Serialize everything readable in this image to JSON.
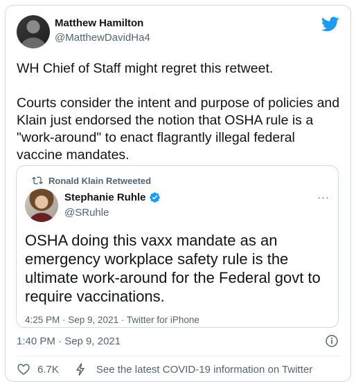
{
  "tweet": {
    "author_name": "Matthew Hamilton",
    "author_handle": "@MatthewDavidHa4",
    "text": "WH Chief of Staff might regret this retweet.\n\nCourts consider the intent and purpose of policies and Klain just endorsed the notion that OSHA rule is a \"work-around\" to enact flagrantly illegal federal vaccine mandates.",
    "timestamp": "1:40 PM · Sep 9, 2021",
    "like_count": "6.7K",
    "covid_link": "See the latest COVID-19 information on Twitter"
  },
  "quoted": {
    "retweeted_by": "Ronald Klain Retweeted",
    "author_name": "Stephanie Ruhle",
    "author_handle": "@SRuhle",
    "more": "···",
    "text": "OSHA doing this vaxx mandate as an emergency workplace safety rule is the ultimate work-around for the Federal govt to require vaccinations.",
    "meta": "4:25 PM · Sep 9, 2021 · Twitter for iPhone"
  },
  "icons": {
    "brand": "twitter-bird-icon",
    "retweet": "retweet-icon",
    "verified": "verified-badge-icon",
    "info": "info-icon",
    "like": "heart-icon",
    "covid": "lightning-bolt-icon"
  },
  "colors": {
    "brand": "#1d9bf0",
    "text": "#0f1419",
    "secondary": "#536471",
    "border": "#cfd9de"
  }
}
